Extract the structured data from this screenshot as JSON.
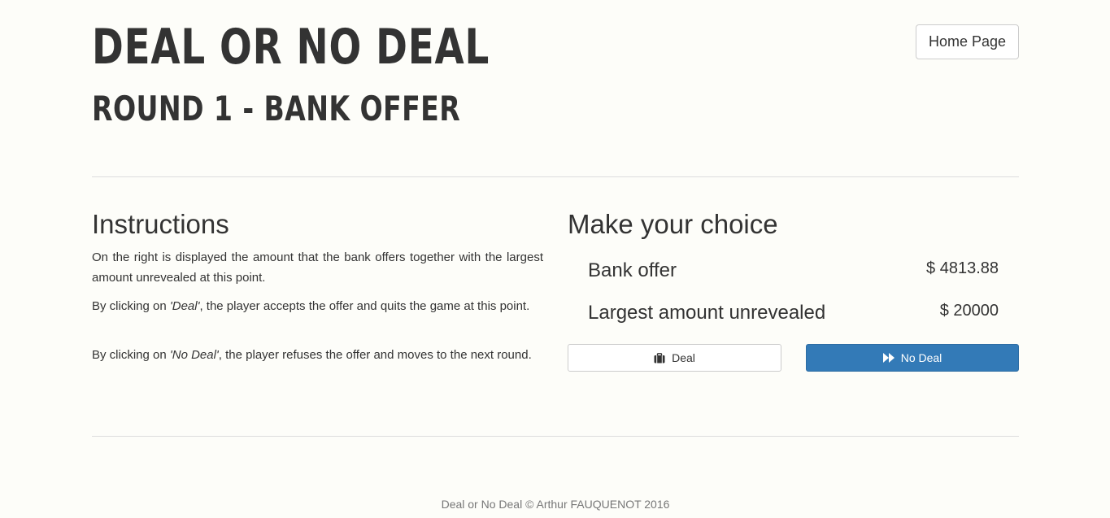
{
  "header": {
    "title": "DEAL OR NO DEAL",
    "subtitle": "ROUND 1 - BANK OFFER",
    "home_button": "Home Page"
  },
  "instructions": {
    "heading": "Instructions",
    "p1": "On the right is displayed the amount that the bank offers together with the largest amount unrevealed at this point.",
    "p2_prefix": "By clicking on ",
    "p2_em": "'Deal'",
    "p2_suffix": ", the player accepts the offer and quits the game at this point.",
    "p3_prefix": "By clicking on ",
    "p3_em": "'No Deal'",
    "p3_suffix": ", the player refuses the offer and moves to the next round."
  },
  "choice": {
    "heading": "Make your choice",
    "bank_offer_label": "Bank offer",
    "bank_offer_value": "$ 4813.88",
    "largest_label": "Largest amount unrevealed",
    "largest_value": "$ 20000",
    "deal_button": "Deal",
    "deal_icon": "briefcase-icon",
    "no_deal_button": "No Deal",
    "no_deal_icon": "fast-forward-icon"
  },
  "colors": {
    "background": "#fdfdf9",
    "primary": "#337ab7",
    "text": "#333333",
    "muted": "#777777"
  },
  "footer": {
    "text": "Deal or No Deal © Arthur FAUQUENOT 2016"
  }
}
